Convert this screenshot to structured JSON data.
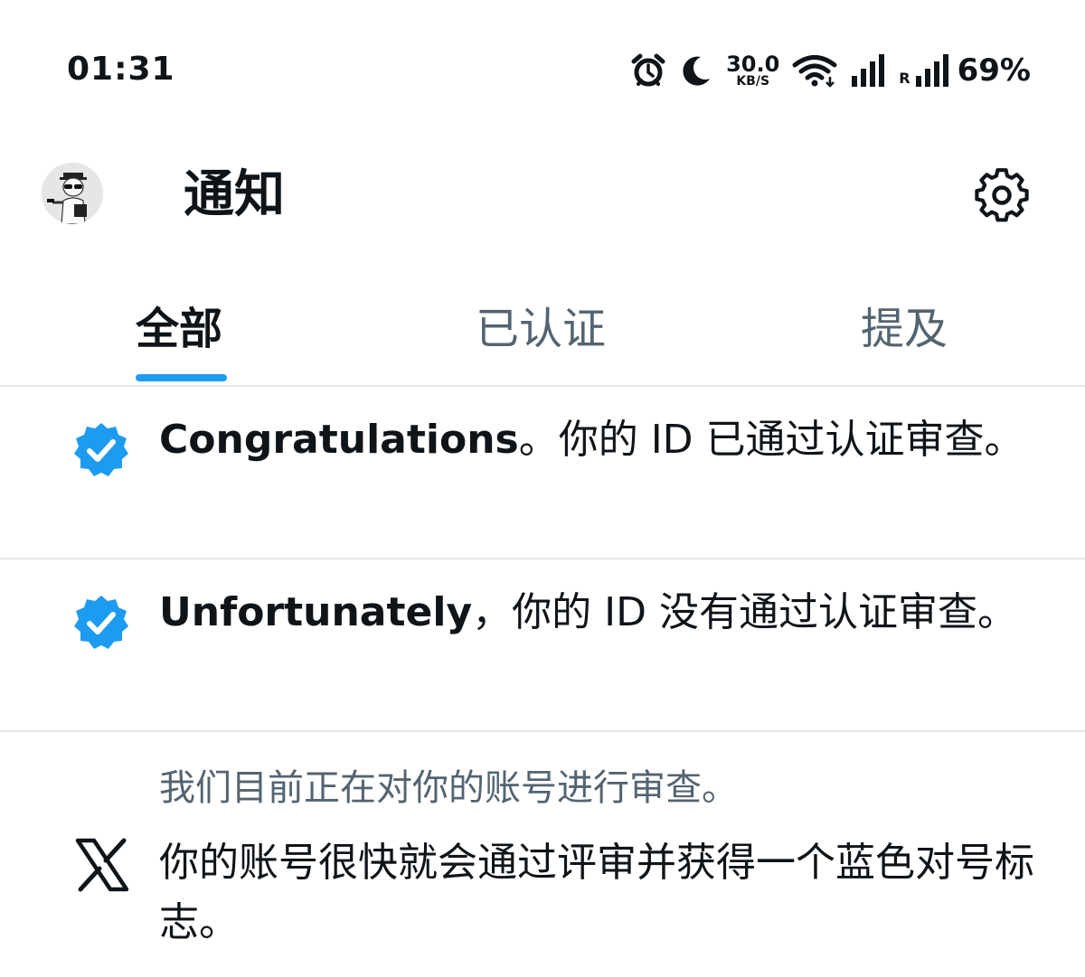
{
  "status_bar": {
    "time": "01:31",
    "net_speed_value": "30.0",
    "net_speed_unit": "KB/S",
    "roaming_label": "R",
    "battery": "69%",
    "icons": [
      "alarm-icon",
      "moon-icon",
      "wifi-icon",
      "signal-icon",
      "signal-icon"
    ]
  },
  "header": {
    "title": "通知",
    "settings_icon": "gear-icon",
    "avatar": "profile-avatar"
  },
  "tabs": [
    {
      "label": "全部",
      "active": true
    },
    {
      "label": "已认证",
      "active": false
    },
    {
      "label": "提及",
      "active": false
    }
  ],
  "colors": {
    "accent": "#1d9bf0",
    "text_primary": "#0f1419",
    "text_secondary": "#536471",
    "divider": "#e1e6ea"
  },
  "notifications": [
    {
      "icon": "verified-badge-icon",
      "bold": "Congratulations",
      "text": "。你的 ID 已通过认证审查。"
    },
    {
      "icon": "verified-badge-icon",
      "bold": "Unfortunately",
      "text": "，你的 ID 没有通过认证审查。"
    },
    {
      "icon": "x-logo-icon",
      "subtext": "我们目前正在对你的账号进行审查。",
      "text": "你的账号很快就会通过评审并获得一个蓝色对号标志。"
    }
  ]
}
